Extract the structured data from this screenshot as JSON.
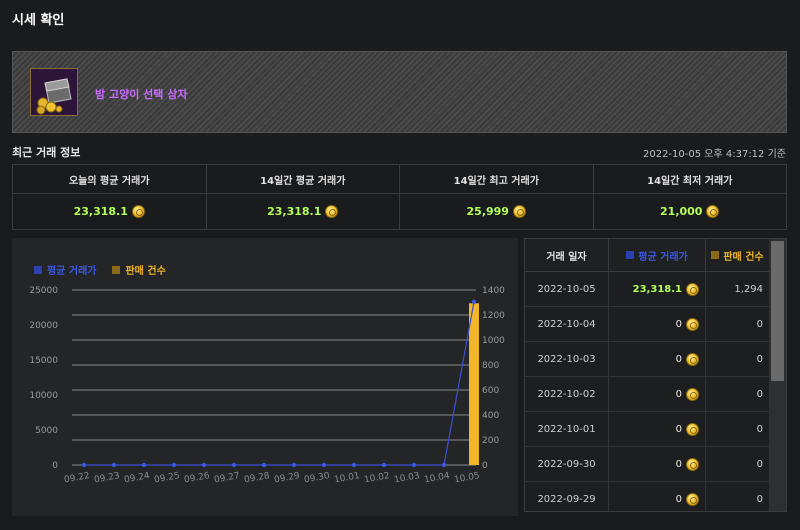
{
  "page": {
    "title": "시세 확인"
  },
  "item": {
    "name": "밤 고양이 선택 상자",
    "icon": "treasure-chest-icon"
  },
  "recent": {
    "label": "최근 거래 정보",
    "timestamp": "2022-10-05 오후 4:37:12 기준"
  },
  "summary": [
    {
      "label": "오늘의 평균 거래가",
      "value": "23,318.1"
    },
    {
      "label": "14일간 평균 거래가",
      "value": "23,318.1"
    },
    {
      "label": "14일간 최고 거래가",
      "value": "25,999"
    },
    {
      "label": "14일간 최저 거래가",
      "value": "21,000"
    }
  ],
  "chart_data": {
    "type": "bar",
    "legend": [
      {
        "label": "평균 거래가",
        "color": "#2a3fb0"
      },
      {
        "label": "판매 건수",
        "color": "#8a6a18"
      }
    ],
    "categories": [
      "09.22",
      "09.23",
      "09.24",
      "09.25",
      "09.26",
      "09.27",
      "09.28",
      "09.29",
      "09.30",
      "10.01",
      "10.02",
      "10.03",
      "10.04",
      "10.05"
    ],
    "series": [
      {
        "name": "평균 거래가",
        "type": "line",
        "axis": "left",
        "color": "#3b4fd6",
        "values": [
          0,
          0,
          0,
          0,
          0,
          0,
          0,
          0,
          0,
          0,
          0,
          0,
          0,
          23318.1
        ]
      },
      {
        "name": "판매 건수",
        "type": "bar",
        "axis": "right",
        "color": "#f0b52a",
        "values": [
          0,
          0,
          0,
          0,
          0,
          0,
          0,
          0,
          0,
          0,
          0,
          0,
          0,
          1294
        ]
      }
    ],
    "left_axis": {
      "ticks": [
        "0",
        "5000",
        "10000",
        "15000",
        "20000",
        "25000"
      ],
      "min": 0,
      "max": 25000
    },
    "right_axis": {
      "ticks": [
        "0",
        "200",
        "400",
        "600",
        "800",
        "1000",
        "1200",
        "1400"
      ],
      "min": 0,
      "max": 1400
    },
    "grid": true,
    "legend_position": "top-left"
  },
  "table": {
    "headers": {
      "date": "거래 일자",
      "price": "평균 거래가",
      "count": "판매 건수"
    },
    "rows": [
      {
        "date": "2022-10-05",
        "price": "23,318.1",
        "count": "1,294"
      },
      {
        "date": "2022-10-04",
        "price": "0",
        "count": "0"
      },
      {
        "date": "2022-10-03",
        "price": "0",
        "count": "0"
      },
      {
        "date": "2022-10-02",
        "price": "0",
        "count": "0"
      },
      {
        "date": "2022-10-01",
        "price": "0",
        "count": "0"
      },
      {
        "date": "2022-09-30",
        "price": "0",
        "count": "0"
      },
      {
        "date": "2022-09-29",
        "price": "0",
        "count": "0"
      }
    ]
  }
}
